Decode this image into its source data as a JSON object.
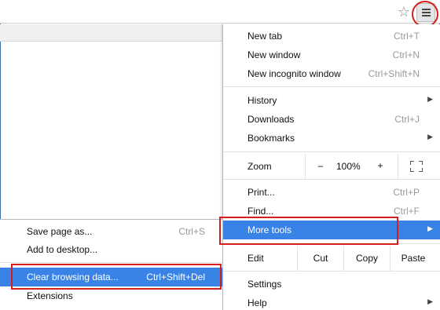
{
  "toolbar": {
    "bookmark_star_icon": "star-icon",
    "menu_icon": "hamburger-menu-icon"
  },
  "menu": {
    "new_tab": {
      "label": "New tab",
      "shortcut": "Ctrl+T"
    },
    "new_window": {
      "label": "New window",
      "shortcut": "Ctrl+N"
    },
    "new_incognito": {
      "label": "New incognito window",
      "shortcut": "Ctrl+Shift+N"
    },
    "history": {
      "label": "History"
    },
    "downloads": {
      "label": "Downloads",
      "shortcut": "Ctrl+J"
    },
    "bookmarks": {
      "label": "Bookmarks"
    },
    "zoom": {
      "label": "Zoom",
      "minus": "–",
      "value": "100%",
      "plus": "+"
    },
    "print": {
      "label": "Print...",
      "shortcut": "Ctrl+P"
    },
    "find": {
      "label": "Find...",
      "shortcut": "Ctrl+F"
    },
    "more_tools": {
      "label": "More tools"
    },
    "edit": {
      "label": "Edit",
      "cut": "Cut",
      "copy": "Copy",
      "paste": "Paste"
    },
    "settings": {
      "label": "Settings"
    },
    "help": {
      "label": "Help"
    }
  },
  "submenu": {
    "save_page": {
      "label": "Save page as...",
      "shortcut": "Ctrl+S"
    },
    "add_to_desktop": {
      "label": "Add to desktop..."
    },
    "clear_browsing": {
      "label": "Clear browsing data...",
      "shortcut": "Ctrl+Shift+Del"
    },
    "extensions": {
      "label": "Extensions"
    }
  },
  "colors": {
    "highlight": "#3a83e6",
    "annotation_red": "#d41e1e",
    "shortcut_gray": "#9a9a9a"
  }
}
